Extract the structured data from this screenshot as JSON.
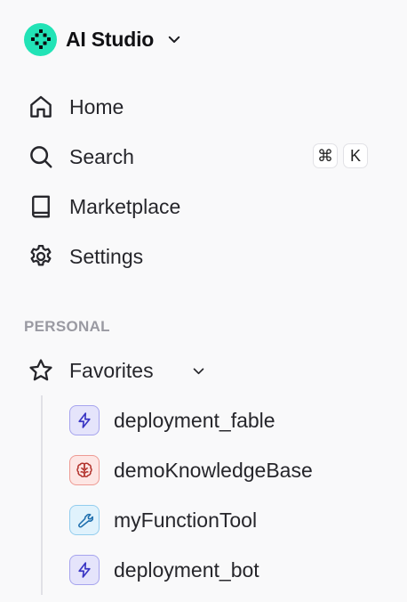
{
  "workspace": {
    "name": "AI Studio",
    "logo_icon": "ai-studio-logo",
    "accent": "#22e3b6"
  },
  "nav": [
    {
      "id": "home",
      "label": "Home",
      "icon": "home-icon"
    },
    {
      "id": "search",
      "label": "Search",
      "icon": "search-icon",
      "shortcut": [
        "⌘",
        "K"
      ]
    },
    {
      "id": "marketplace",
      "label": "Marketplace",
      "icon": "book-icon"
    },
    {
      "id": "settings",
      "label": "Settings",
      "icon": "gear-icon"
    }
  ],
  "personal": {
    "section_label": "PERSONAL",
    "favorites_label": "Favorites",
    "favorites_icon": "star-icon",
    "items": [
      {
        "label": "deployment_fable",
        "type": "deployment",
        "icon": "lightning-icon",
        "color": "#5b57d9"
      },
      {
        "label": "demoKnowledgeBase",
        "type": "knowledge-base",
        "icon": "brain-icon",
        "color": "#c2413a"
      },
      {
        "label": "myFunctionTool",
        "type": "tool",
        "icon": "wrench-icon",
        "color": "#2a86c9"
      },
      {
        "label": "deployment_bot",
        "type": "deployment",
        "icon": "lightning-icon",
        "color": "#5b57d9"
      }
    ]
  }
}
